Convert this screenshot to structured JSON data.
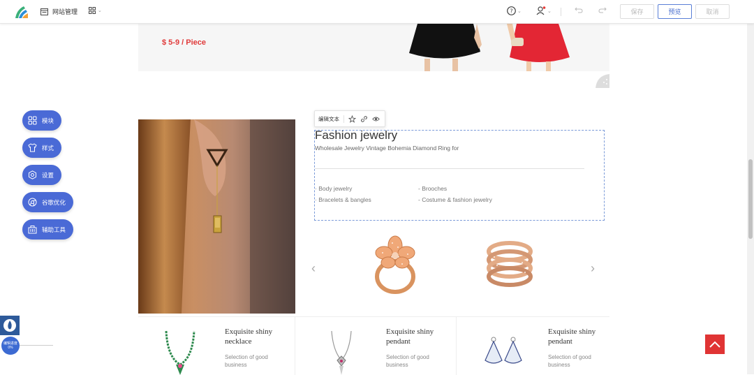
{
  "topbar": {
    "site_management": "网站管理",
    "save": "保存",
    "preview": "预览",
    "cancel": "取消"
  },
  "banner": {
    "price": "$ 5-9 / Piece"
  },
  "edit_toolbar": {
    "edit_text": "编辑文本"
  },
  "content": {
    "title": "Fashion jewelry",
    "subtitle": "Wholesale Jewelry Vintage Bohemia Diamond Ring for",
    "list": [
      "· Body jewelry",
      "- Brooches",
      "· Bracelets & bangles",
      "- Costume & fashion jewelry"
    ]
  },
  "cards": [
    {
      "name": "Exquisite shiny necklace",
      "desc": "Selection of good business"
    },
    {
      "name": "Exquisite shiny pendant",
      "desc": "Selection of good business"
    },
    {
      "name": "Exquisite shiny pendant",
      "desc": "Selection of good business"
    }
  ],
  "sidebar": {
    "items": [
      {
        "label": "模块",
        "icon": "grid-icon"
      },
      {
        "label": "样式",
        "icon": "shirt-icon"
      },
      {
        "label": "设置",
        "icon": "gear-icon"
      },
      {
        "label": "谷歌优化",
        "icon": "chrome-icon"
      },
      {
        "label": "辅助工具",
        "icon": "toolbox-icon"
      }
    ]
  },
  "mini_widget": {
    "label": "编辑进度",
    "percent": "0%"
  },
  "colors": {
    "accent": "#4a6ad6",
    "price_red": "#e03a3a",
    "to_top": "#e03434"
  }
}
